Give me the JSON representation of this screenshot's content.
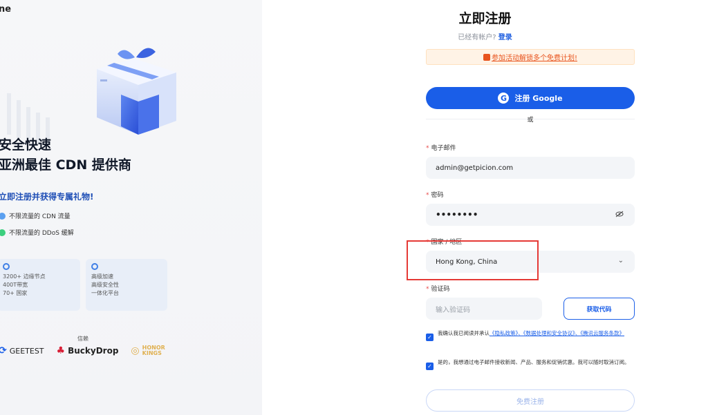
{
  "left": {
    "brand_fragment": "ne",
    "headline_line1": "安全快速",
    "headline_line2": "亚洲最佳 CDN 提供商",
    "gift_title": "立即注册并获得专属礼物!",
    "features": [
      "不限流量的 CDN 流量",
      "不限流量的 DDoS 缓解"
    ],
    "card1": [
      "3200+ 边缘节点",
      "400T带宽",
      "70+ 国家"
    ],
    "card2": [
      "高级加速",
      "高级安全性",
      "一体化平台"
    ],
    "sponsor_label": "信赖",
    "sponsors": [
      "GEETEST",
      "BuckyDrop",
      "HONOR KINGS"
    ]
  },
  "form": {
    "title": "立即注册",
    "has_account": "已经有帐户?",
    "login_link": "登录",
    "promo": "参加活动解锁多个免费计划!",
    "google_btn": "注册 Google",
    "or": "或",
    "email_label": "电子邮件",
    "email_value": "admin@getpicion.com",
    "password_label": "密码",
    "password_value": "••••••••",
    "region_label": "国家 / 地区",
    "region_value": "Hong Kong, China",
    "code_label": "验证码",
    "code_placeholder": "输入验证码",
    "get_code_btn": "获取代码",
    "consent1_prefix": "我确认我已阅读并承认",
    "consent1_links": "《隐私政策》、《数据处理和安全协议》、《腾讯云服务条款》",
    "consent2": "是的，我想通过电子邮件接收新闻、产品、服务和促销优惠。我可以随时取消订阅。",
    "submit_btn": "免费注册"
  },
  "colors": {
    "accent": "#1a5ee8",
    "promo": "#e8541e",
    "highlight": "#e53935"
  }
}
